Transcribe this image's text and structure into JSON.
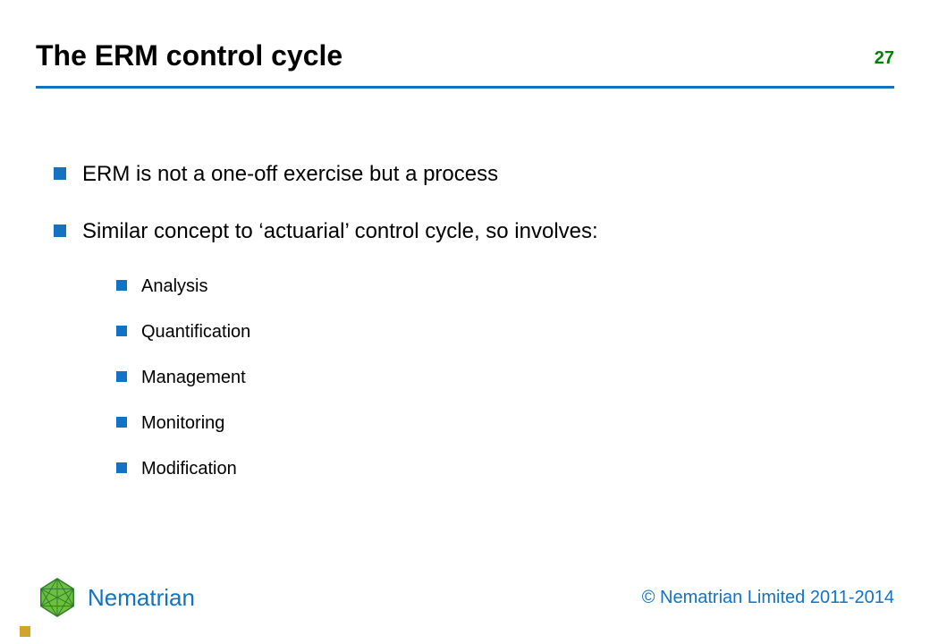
{
  "header": {
    "title": "The ERM control cycle",
    "page_number": "27"
  },
  "body": {
    "bullets": [
      {
        "text": "ERM is not a one-off exercise but a process"
      },
      {
        "text": "Similar concept to ‘actuarial’ control cycle, so involves:"
      }
    ],
    "sub_bullets": [
      {
        "text": "Analysis"
      },
      {
        "text": "Quantification"
      },
      {
        "text": "Management"
      },
      {
        "text": "Monitoring"
      },
      {
        "text": "Modification"
      }
    ]
  },
  "footer": {
    "brand_name": "Nematrian",
    "copyright": "© Nematrian Limited 2011-2014"
  },
  "colors": {
    "accent_blue": "#1273c4",
    "page_number_green": "#008000",
    "logo_green_dark": "#2f7a2f",
    "logo_green_light": "#6fbf3f",
    "gold": "#d4a32a"
  }
}
